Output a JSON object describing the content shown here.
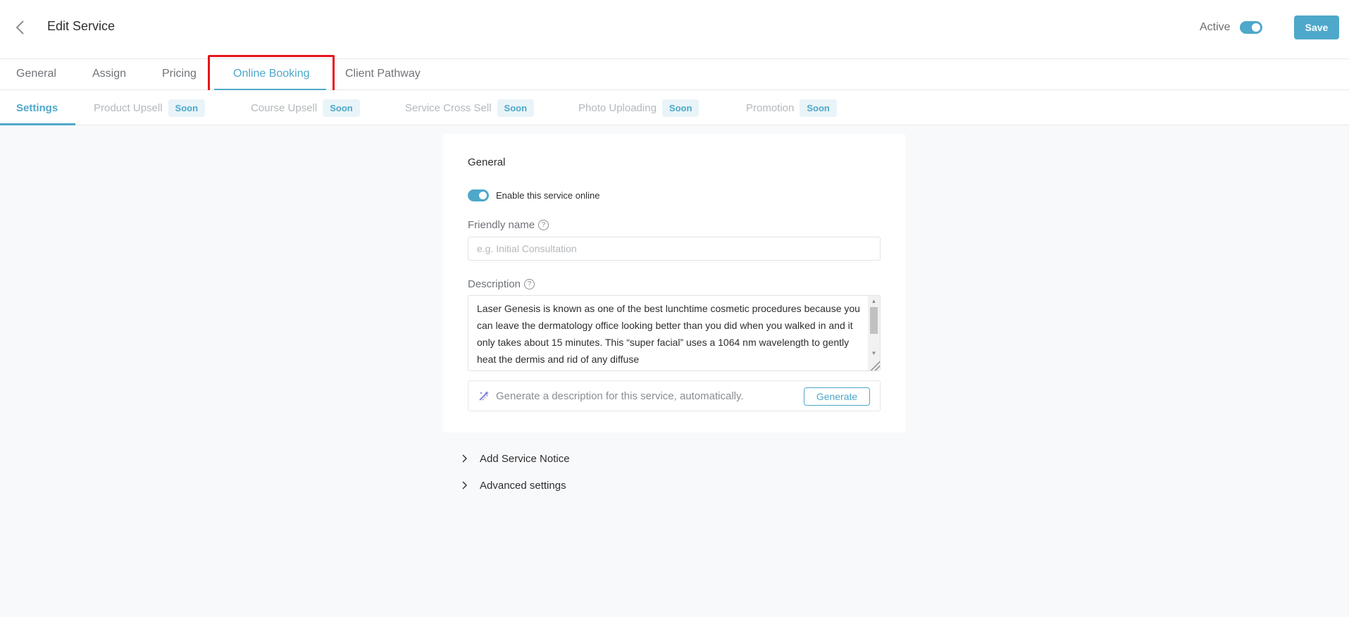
{
  "header": {
    "title": "Edit Service",
    "active_label": "Active",
    "active_on": true,
    "save_label": "Save"
  },
  "main_tabs": [
    {
      "label": "General"
    },
    {
      "label": "Assign"
    },
    {
      "label": "Pricing"
    },
    {
      "label": "Online Booking",
      "active": true
    },
    {
      "label": "Client Pathway"
    }
  ],
  "sub_tabs": [
    {
      "label": "Settings",
      "active": true
    },
    {
      "label": "Product Upsell",
      "badge": "Soon"
    },
    {
      "label": "Course Upsell",
      "badge": "Soon"
    },
    {
      "label": "Service Cross Sell",
      "badge": "Soon"
    },
    {
      "label": "Photo Uploading",
      "badge": "Soon"
    },
    {
      "label": "Promotion",
      "badge": "Soon"
    }
  ],
  "general": {
    "section_title": "General",
    "enable_label": "Enable this service online",
    "enabled": true,
    "friendly_name_label": "Friendly name",
    "friendly_name_placeholder": "e.g. Initial Consultation",
    "friendly_name_value": "",
    "description_label": "Description",
    "description_value": "Laser Genesis is known as one of the best lunchtime cosmetic procedures because you can leave the dermatology office looking better than you did when you walked in and it only takes about 15 minutes. This “super facial” uses a 1064 nm wavelength to gently heat the dermis and rid of any diffuse",
    "generate_hint": "Generate a description for this service, automatically.",
    "generate_label": "Generate"
  },
  "expanders": {
    "service_notice": "Add Service Notice",
    "advanced": "Advanced settings"
  },
  "colors": {
    "accent": "#4ea8ca",
    "highlight": "#e8141b",
    "background": "#f8f9fb"
  }
}
